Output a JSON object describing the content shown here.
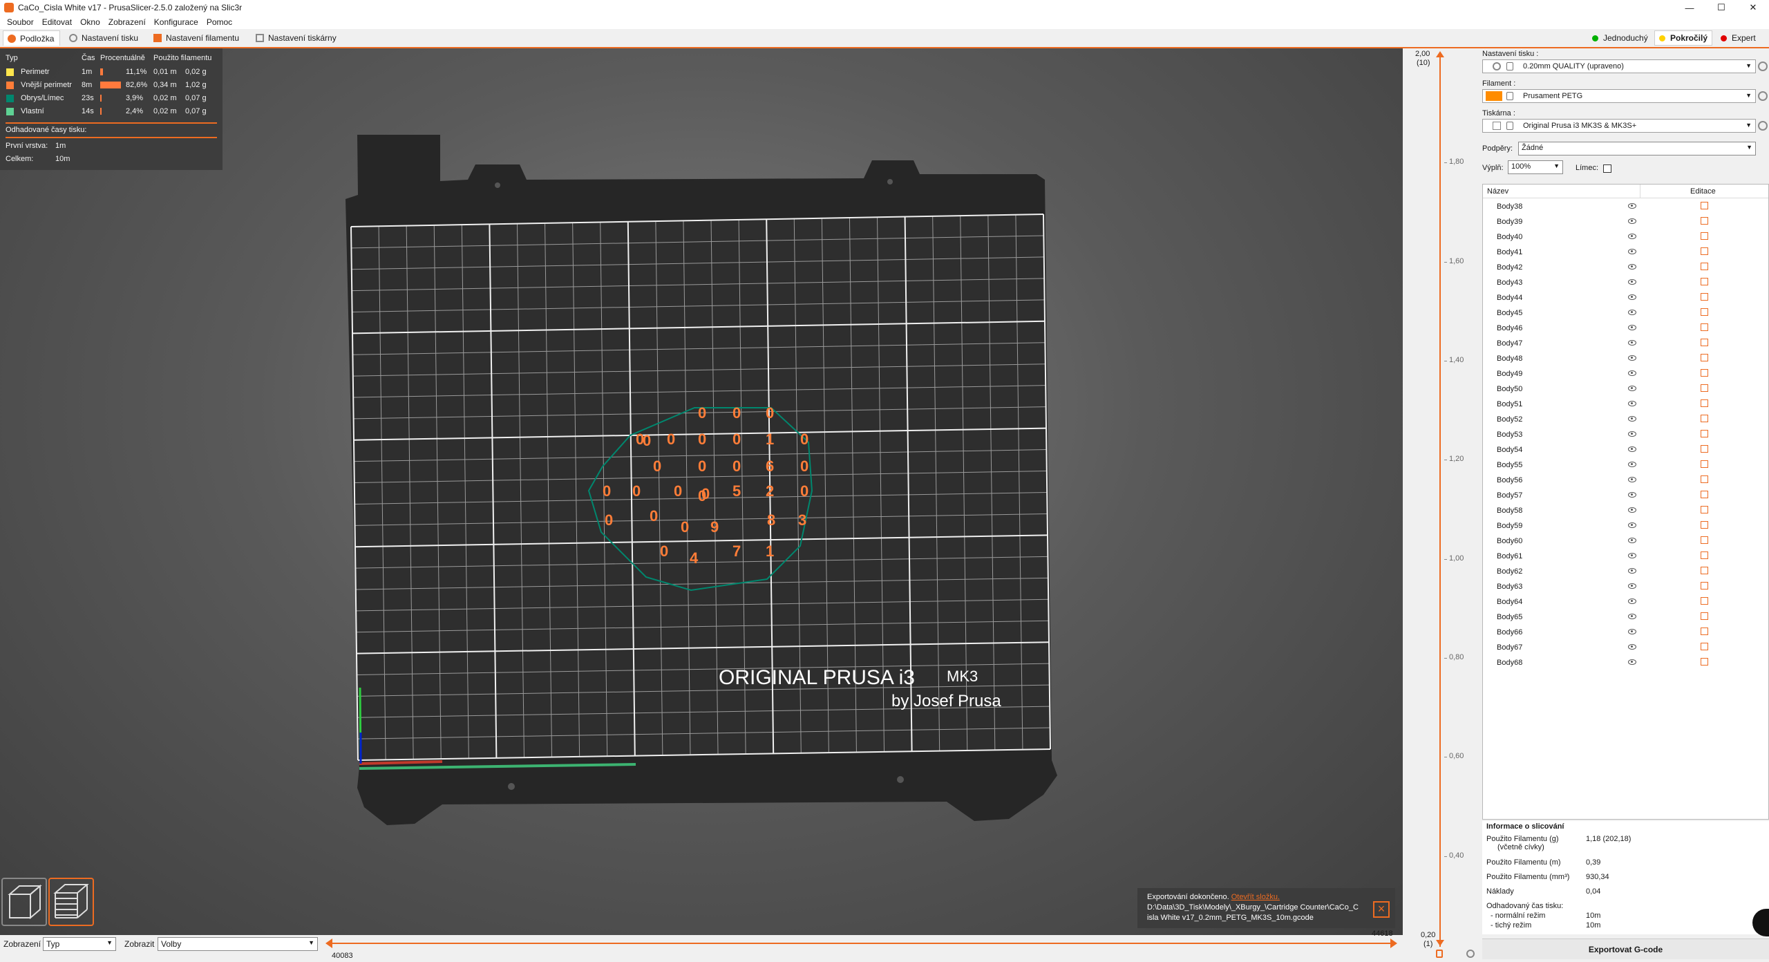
{
  "window": {
    "title": "CaCo_Cisla White v17 - PrusaSlicer-2.5.0 založený na Slic3r",
    "minimize": "—",
    "maximize": "☐",
    "close": "✕"
  },
  "menu": [
    "Soubor",
    "Editovat",
    "Okno",
    "Zobrazení",
    "Konfigurace",
    "Pomoc"
  ],
  "tabs": [
    {
      "label": "Podložka",
      "icon": "plater-icon"
    },
    {
      "label": "Nastavení tisku",
      "icon": "cog-icon"
    },
    {
      "label": "Nastavení filamentu",
      "icon": "spool-icon"
    },
    {
      "label": "Nastavení tiskárny",
      "icon": "printer-icon"
    }
  ],
  "modes": [
    {
      "label": "Jednoduchý",
      "color": "#00b000"
    },
    {
      "label": "Pokročilý",
      "color": "#ffd200"
    },
    {
      "label": "Expert",
      "color": "#e00000"
    }
  ],
  "legend": {
    "headers": {
      "type": "Typ",
      "time": "Čas",
      "percent": "Procentuálně",
      "used": "Použito filamentu"
    },
    "rows": [
      {
        "name": "Perimetr",
        "color": "#ffe64d",
        "time": "1m",
        "percent": "11,1%",
        "pct": 11.1,
        "m": "0,01 m",
        "g": "0,02 g"
      },
      {
        "name": "Vnější perimetr",
        "color": "#ff7d38",
        "time": "8m",
        "percent": "82,6%",
        "pct": 82.6,
        "m": "0,34 m",
        "g": "1,02 g"
      },
      {
        "name": "Obrys/Límec",
        "color": "#00876e",
        "time": "23s",
        "percent": "3,9%",
        "pct": 3.9,
        "m": "0,02 m",
        "g": "0,07 g"
      },
      {
        "name": "Vlastní",
        "color": "#5ed194",
        "time": "14s",
        "percent": "2,4%",
        "pct": 2.4,
        "m": "0,02 m",
        "g": "0,07 g"
      }
    ],
    "estimated_label": "Odhadované časy tisku:",
    "first_layer_label": "První vrstva:",
    "first_layer_value": "1m",
    "total_label": "Celkem:",
    "total_value": "10m"
  },
  "bed": {
    "line1": "ORIGINAL PRUSA i3",
    "line1b": "MK3",
    "line2": "by Josef Prusa"
  },
  "digits": [
    "0",
    "0",
    "0",
    "0",
    "0",
    "0",
    "0",
    "1",
    "0",
    "0",
    "0",
    "0",
    "6",
    "0",
    "0",
    "0",
    "0",
    "0",
    "5",
    "2",
    "0",
    "0",
    "0",
    "0",
    "9",
    "8",
    "3",
    "0",
    "4",
    "7",
    "1",
    "0",
    "0"
  ],
  "notification": {
    "text": "Exportování dokončeno.",
    "link": "Otevřít složku.",
    "path1": "D:\\Data\\3D_Tisk\\Modely\\_XBurgy_\\Cartridge Counter\\CaCo_C",
    "path2": "isla White v17_0.2mm_PETG_MK3S_10m.gcode"
  },
  "bottom": {
    "view_label": "Zobrazení",
    "view_value": "Typ",
    "show_label": "Zobrazit",
    "show_value": "Volby",
    "slider_right": "44618",
    "slider_left": "40083"
  },
  "vslider": {
    "top_value": "2,00",
    "top_layer": "(10)",
    "bottom_value": "0,20",
    "bottom_layer": "(1)",
    "ticks": [
      "2,00",
      "1,80",
      "1,60",
      "1,40",
      "1,20",
      "1,00",
      "0,80",
      "0,60",
      "0,40",
      "0,20"
    ]
  },
  "panel": {
    "print_label": "Nastavení tisku :",
    "print_value": "0.20mm QUALITY (upraveno)",
    "filament_label": "Filament :",
    "filament_value": "Prusament PETG",
    "filament_color": "#ff8c00",
    "printer_label": "Tiskárna :",
    "printer_value": "Original Prusa i3 MK3S & MK3S+",
    "supports_label": "Podpěry:",
    "supports_value": "Žádné",
    "infill_label": "Výplň:",
    "infill_value": "100%",
    "brim_label": "Límec:",
    "col_name": "Název",
    "col_edit": "Editace",
    "objects": [
      "Body38",
      "Body39",
      "Body40",
      "Body41",
      "Body42",
      "Body43",
      "Body44",
      "Body45",
      "Body46",
      "Body47",
      "Body48",
      "Body49",
      "Body50",
      "Body51",
      "Body52",
      "Body53",
      "Body54",
      "Body55",
      "Body56",
      "Body57",
      "Body58",
      "Body59",
      "Body60",
      "Body61",
      "Body62",
      "Body63",
      "Body64",
      "Body65",
      "Body66",
      "Body67",
      "Body68"
    ],
    "info_title": "Informace o slicování",
    "info": [
      {
        "k": "Použito Filamentu (g)",
        "k2": "(včetně cívky)",
        "v": "1,18 (202,18)"
      },
      {
        "k": "Použito Filamentu (m)",
        "v": "0,39"
      },
      {
        "k": "Použito Filamentu (mm³)",
        "v": "930,34"
      },
      {
        "k": "Náklady",
        "v": "0,04"
      }
    ],
    "time_label": "Odhadovaný čas tisku:",
    "normal_label": "- normální režim",
    "normal_value": "10m",
    "quiet_label": "- tichý režim",
    "quiet_value": "10m",
    "export_label": "Exportovat G-code"
  }
}
